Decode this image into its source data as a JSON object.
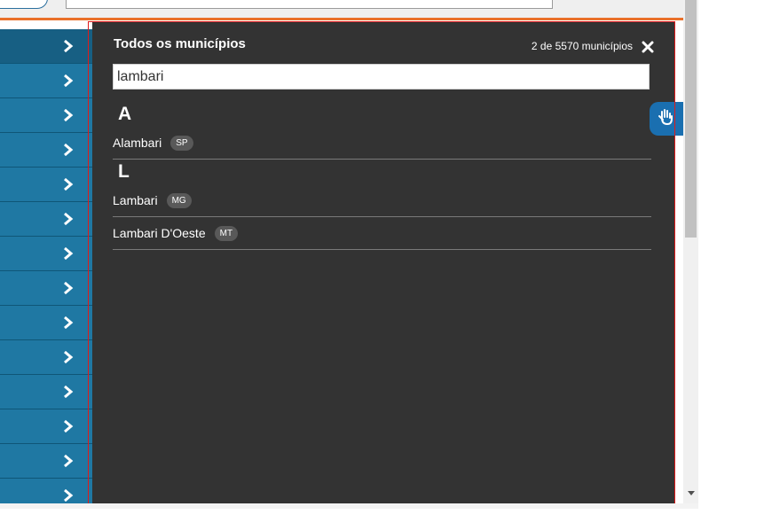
{
  "panel": {
    "title": "Todos os municípios",
    "count": "2 de 5570 municípios",
    "search_value": "lambari",
    "groups": [
      {
        "letter": "A",
        "items": [
          {
            "name": "Alambari",
            "state": "SP"
          }
        ]
      },
      {
        "letter": "L",
        "items": [
          {
            "name": "Lambari",
            "state": "MG"
          },
          {
            "name": "Lambari D'Oeste",
            "state": "MT"
          }
        ]
      }
    ]
  },
  "icons": {
    "close": "close-icon",
    "chevron": "chevron-right-icon",
    "libras": "libras-hand-icon",
    "scroll_down": "scroll-down-arrow-icon"
  },
  "colors": {
    "panel_bg": "#333333",
    "sidebar_bg": "#1f78a3",
    "accent_orange": "#e9702a",
    "frame_red": "#e01a1a"
  }
}
